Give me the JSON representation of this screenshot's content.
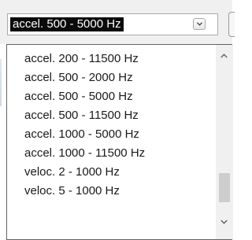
{
  "combo": {
    "selected_value": "accel. 500 - 5000 Hz"
  },
  "dropdown": {
    "options": [
      "accel. 200 - 11500 Hz",
      "accel. 500 - 2000 Hz",
      "accel. 500 - 5000 Hz",
      "accel. 500 - 11500 Hz",
      "accel. 1000 - 5000 Hz",
      "accel. 1000 - 11500 Hz",
      "veloc. 2 - 1000 Hz",
      "veloc. 5 - 1000 Hz"
    ],
    "scroll_position": 0.9
  },
  "icons": {
    "dropdown_button": "chevron-down-icon",
    "scroll_up": "chevron-up-icon",
    "scroll_down": "chevron-down-icon"
  },
  "colors": {
    "selection_background": "#0a0a0a",
    "selection_text": "#ffffff",
    "list_border": "#646464",
    "scrollbar_track": "#f0f0f0",
    "scrollbar_thumb": "#cdcdcd"
  }
}
